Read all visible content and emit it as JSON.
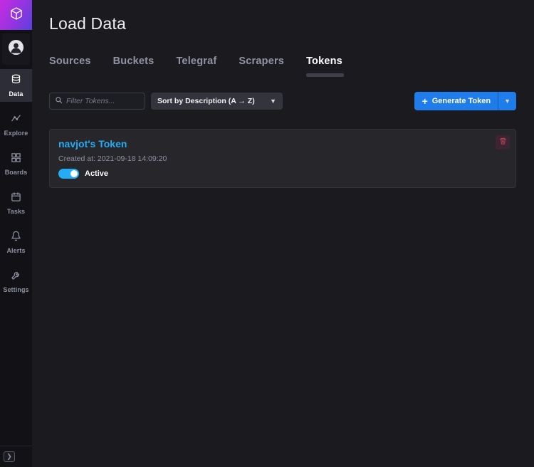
{
  "colors": {
    "accent_blue": "#22adf6",
    "button_blue": "#1e7ceb",
    "danger_red": "#c2455a",
    "sidebar_bg": "#111116",
    "main_bg": "#1b1b1f",
    "card_bg": "#26262b"
  },
  "sidebar": {
    "logo_icon": "influxdb-logo",
    "avatar_icon": "user-avatar",
    "items": [
      {
        "label": "Data",
        "icon": "database-icon",
        "active": true
      },
      {
        "label": "Explore",
        "icon": "graph-icon",
        "active": false
      },
      {
        "label": "Boards",
        "icon": "dashboards-icon",
        "active": false
      },
      {
        "label": "Tasks",
        "icon": "calendar-icon",
        "active": false
      },
      {
        "label": "Alerts",
        "icon": "bell-icon",
        "active": false
      },
      {
        "label": "Settings",
        "icon": "wrench-icon",
        "active": false
      }
    ],
    "bottom_icon": "collapse-expander-icon"
  },
  "page": {
    "title": "Load Data"
  },
  "tabs": [
    {
      "label": "Sources",
      "active": false
    },
    {
      "label": "Buckets",
      "active": false
    },
    {
      "label": "Telegraf",
      "active": false
    },
    {
      "label": "Scrapers",
      "active": false
    },
    {
      "label": "Tokens",
      "active": true
    }
  ],
  "toolbar": {
    "filter_placeholder": "Filter Tokens...",
    "filter_value": "",
    "sort_button": "Sort by Description (A → Z)",
    "generate_button": "Generate Token"
  },
  "tokens": [
    {
      "name": "navjot's Token",
      "created_at": "Created at: 2021-09-18 14:09:20",
      "status_label": "Active",
      "status_on": true
    }
  ]
}
